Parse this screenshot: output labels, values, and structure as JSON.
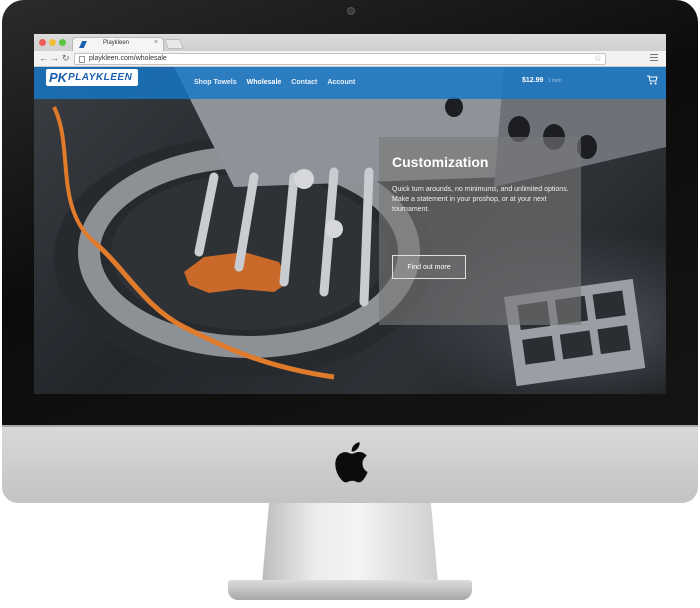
{
  "browser": {
    "tab_title": "Playkleen",
    "tab_close": "×",
    "url": "playkleen.com/wholesale"
  },
  "site": {
    "logo_text": "PLAYKLEEN",
    "logo_mark": "PK",
    "nav": [
      {
        "label": "Shop Towels"
      },
      {
        "label": "Wholesale"
      },
      {
        "label": "Contact"
      },
      {
        "label": "Account"
      }
    ],
    "cart_price": "$12.99",
    "cart_sub": "1 item",
    "accent_color": "#1678c8"
  },
  "promo": {
    "title": "Customization",
    "body": "Quick turn arounds, no minimums, and unlimited options. Make a statement in your proshop, or at your next tournament.",
    "button_label": "Find out more"
  },
  "icons": {
    "back": "arrow-left-icon",
    "forward": "arrow-right-icon",
    "reload": "reload-icon",
    "bookmark": "star-icon",
    "menu": "hamburger-menu-icon",
    "cart": "shopping-cart-icon",
    "brand": "apple-logo-icon"
  }
}
